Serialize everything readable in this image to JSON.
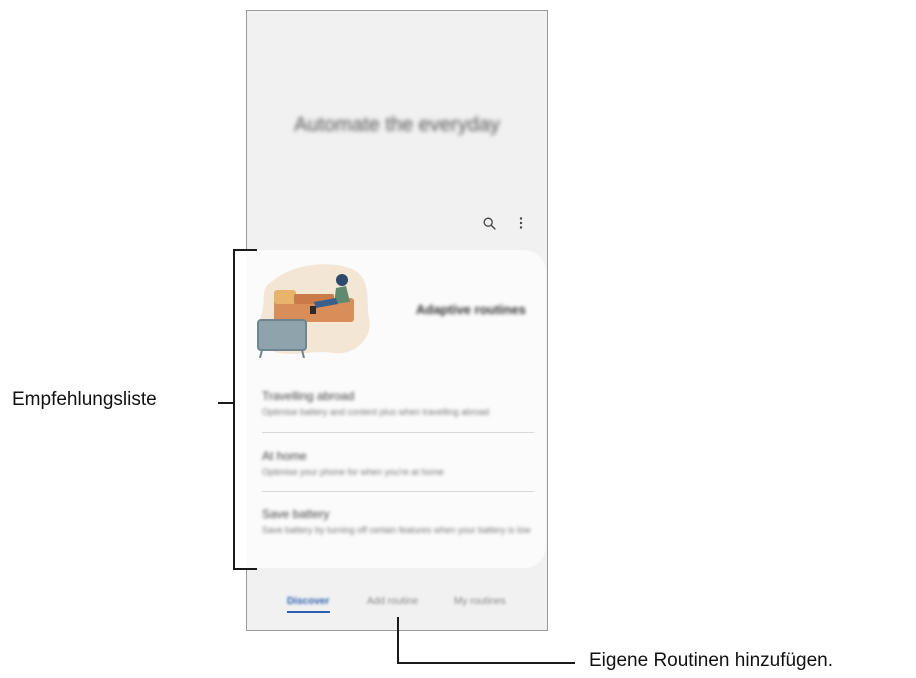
{
  "header": {
    "title": "Automate the everyday"
  },
  "toolbar": {
    "search_icon": "search-icon",
    "more_icon": "more-vertical-icon"
  },
  "hero": {
    "title": "Adaptive routines"
  },
  "list": [
    {
      "title": "Travelling abroad",
      "desc": "Optimise battery and content plus when travelling abroad"
    },
    {
      "title": "At home",
      "desc": "Optimise your phone for when you're at home"
    },
    {
      "title": "Save battery",
      "desc": "Save battery by turning off certain features when your battery is low"
    }
  ],
  "tabs": [
    {
      "label": "Discover",
      "active": true
    },
    {
      "label": "Add routine",
      "active": false
    },
    {
      "label": "My routines",
      "active": false
    }
  ],
  "annotations": {
    "list_label": "Empfehlungsliste",
    "add_label": "Eigene Routinen hinzufügen."
  },
  "colors": {
    "accent": "#2d5fb0",
    "screen_bg": "#f1f1f1",
    "card_bg": "#fbfbfb"
  }
}
